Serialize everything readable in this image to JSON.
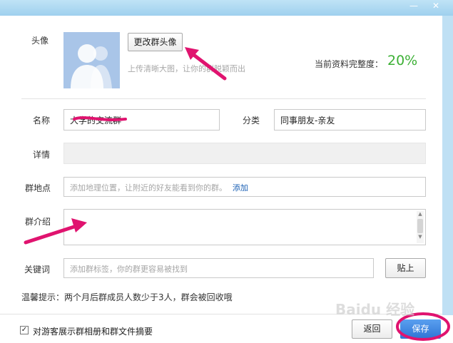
{
  "window": {
    "minimize_glyph": "—",
    "close_glyph": "✕"
  },
  "avatar_section": {
    "label": "头像",
    "change_button": "更改群头像",
    "hint": "上传清晰大图，让你的群脱颖而出",
    "completeness_label": "当前资料完整度：",
    "completeness_value": "20%"
  },
  "form": {
    "name_label": "名称",
    "name_value": "大学的交流群",
    "category_label": "分类",
    "category_value": "同事朋友-亲友",
    "details_label": "详情",
    "location_label": "群地点",
    "location_placeholder": "添加地理位置，让附近的好友能看到你的群。",
    "location_add_link": "添加",
    "intro_label": "群介绍",
    "keywords_label": "关键词",
    "keywords_placeholder": "添加群标签，你的群更容易被找到",
    "paste_button": "贴上"
  },
  "notice": "温馨提示：两个月后群成员人数少于3人，群会被回收哦",
  "footer": {
    "checkbox_label": "对游客展示群相册和群文件摘要",
    "checkbox_checked": true,
    "back_button": "返回",
    "save_button": "保存"
  },
  "colors": {
    "accent_green": "#3cb035",
    "link_blue": "#1a5fb4",
    "annotation_pink": "#e0136f",
    "save_blue": "#3f86e6"
  },
  "watermark": "Baidu 经验"
}
